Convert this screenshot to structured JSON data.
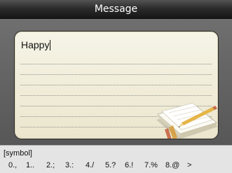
{
  "title_bar": {
    "title": "Message"
  },
  "editor": {
    "text": "Happy",
    "icon": "notepad-pencil-icon"
  },
  "input_bar": {
    "mode_label": "[symbol]",
    "keys": [
      "0.,",
      "1..",
      "2.;",
      "3.:",
      "4./",
      "5.?",
      "6.!",
      "7.%",
      "8.@",
      ">"
    ]
  },
  "colors": {
    "title_bar": "#1f1f1f",
    "panel": "#646464",
    "note_paper": "#f1eedb",
    "status_bar": "#e4e4e4"
  }
}
